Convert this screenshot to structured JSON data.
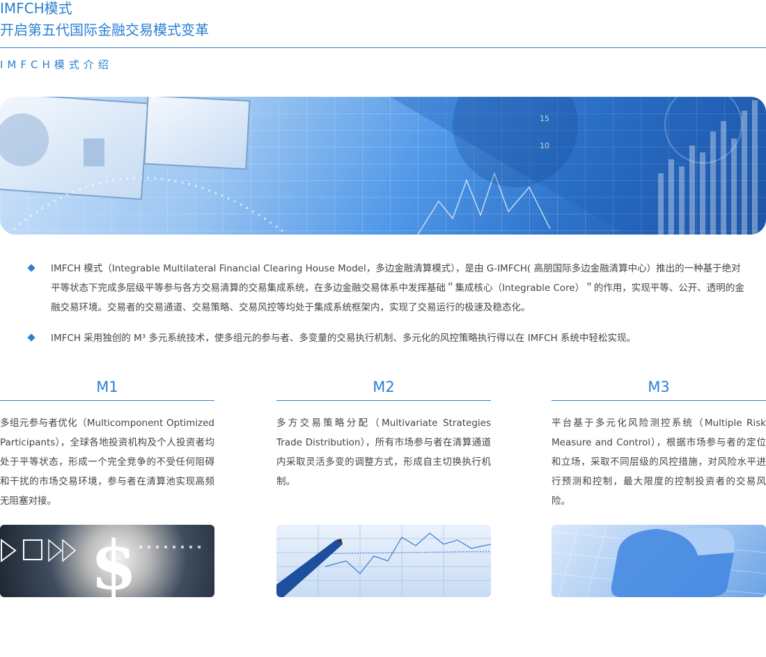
{
  "header": {
    "title": "IMFCH模式",
    "tagline": "开启第五代国际金融交易模式变革",
    "section": "IMFCH模式介绍"
  },
  "colors": {
    "accent": "#2a7fd4"
  },
  "bullets": [
    {
      "text": "IMFCH 模式（Integrable Multilateral Financial Clearing House Model，多边金融清算模式），是由 G-IMFCH( 高朋国际多边金融清算中心）推出的一种基于绝对平等状态下完成多层级平等参与各方交易清算的交易集成系统，在多边金融交易体系中发挥基础＂集成核心（Integrable Core）＂的作用，实现平等、公开、透明的金融交易环境。交易者的交易通道、交易策略、交易风控等均处于集成系统框架内，实现了交易运行的极速及稳态化。"
    },
    {
      "text": "IMFCH 采用独创的 M³ 多元系统技术，使多组元的参与者、多变量的交易执行机制、多元化的风控策略执行得以在 IMFCH 系统中轻松实现。"
    }
  ],
  "columns": [
    {
      "title": "M1",
      "text": "多组元参与者优化（Multicomponent Optimized Participants），全球各地投资机构及个人投资者均处于平等状态，形成一个完全竞争的不受任何阻碍和干扰的市场交易环境，参与者在清算池实现高频无阻塞对接。",
      "image": "dollar-sign-image"
    },
    {
      "title": "M2",
      "text": "多方交易策略分配（Multivariate Strategies Trade Distribution），所有市场参与者在清算通道内采取灵活多变的调整方式，形成自主切换执行机制。",
      "image": "pen-chart-image"
    },
    {
      "title": "M3",
      "text": "平台基于多元化风险测控系统（Multiple Risk Measure and Control），根据市场参与者的定位和立场，采取不同层级的风控措施，对风险水平进行预测和控制，最大限度的控制投资者的交易风险。",
      "image": "security-cube-image"
    }
  ],
  "banner": {
    "image": "currency-chart-banner",
    "chart_ticks": [
      "15",
      "10"
    ]
  }
}
